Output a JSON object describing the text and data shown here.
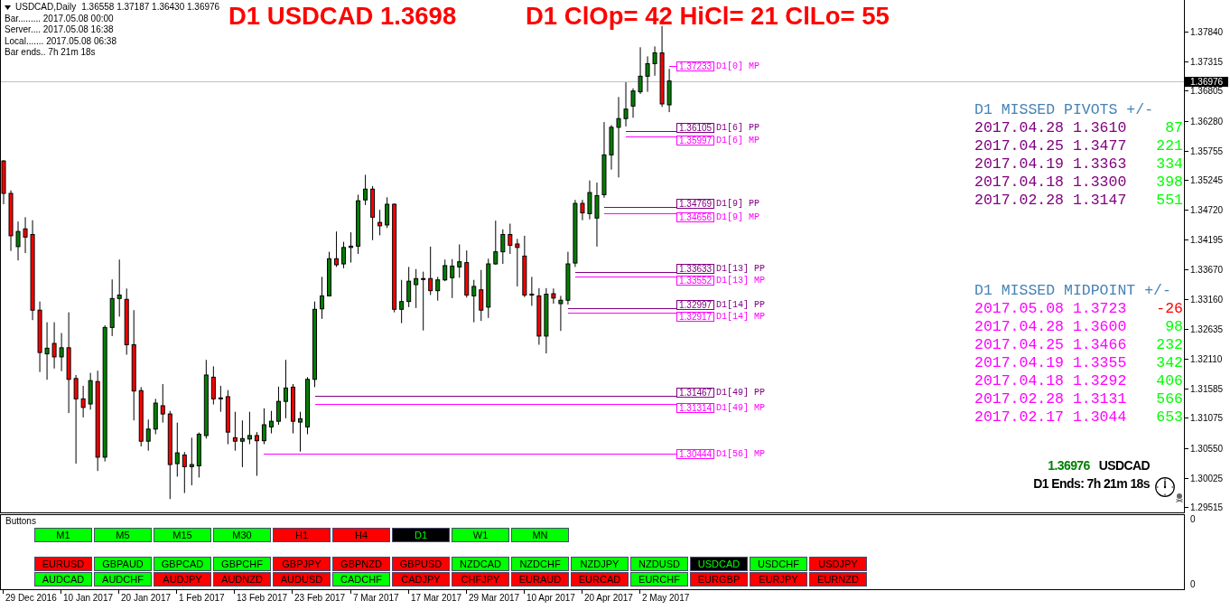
{
  "chart": {
    "symbol": "USDCAD,Daily",
    "ohlc": "1.36558 1.37187 1.36430 1.36976",
    "info": [
      "Bar......... 2017.05.08 00:00",
      "Server.... 2017.05.08 16:38",
      "Local....... 2017.05.08 06:38",
      "Bar ends.. 7h 21m 18s"
    ],
    "headlines": [
      "D1 USDCAD 1.3698",
      "D1 ClOp= 42 HiCl= 21 ClLo= 55"
    ],
    "chart_data": {
      "type": "candlestick",
      "categories": [
        null,
        null,
        null,
        null,
        null,
        null,
        null,
        null,
        null,
        null,
        null,
        null,
        null,
        null,
        null,
        null,
        null,
        null,
        null,
        null,
        null,
        null,
        null,
        null,
        null,
        null,
        null,
        null,
        null,
        null,
        null,
        null,
        null,
        null,
        null,
        null,
        null,
        null,
        null,
        null,
        null,
        null,
        null,
        null,
        null,
        null,
        null,
        null,
        null,
        null,
        null,
        null,
        null,
        null,
        null,
        null,
        null,
        null,
        null,
        null,
        null,
        null,
        null,
        null,
        null,
        null,
        null,
        null,
        null,
        null,
        null,
        null,
        null,
        null,
        null,
        null,
        null,
        null,
        null,
        null,
        null,
        null,
        null,
        null,
        null,
        null,
        null,
        null,
        null,
        null,
        null,
        null,
        null,
        null,
        null,
        null,
        null,
        null,
        null,
        null,
        null,
        null,
        null,
        null,
        null,
        null,
        null,
        null,
        null,
        null,
        null,
        null,
        null,
        null,
        null,
        null,
        null,
        null,
        null,
        null,
        null,
        null,
        null,
        null,
        null,
        null,
        null,
        null,
        null,
        null,
        null,
        null,
        null,
        null,
        null,
        null,
        null,
        null,
        null,
        null,
        null,
        null,
        null,
        null,
        null,
        null,
        null,
        null,
        null,
        null,
        null,
        null,
        null,
        null,
        null,
        null,
        null,
        null,
        null,
        null,
        null,
        null,
        null,
        null,
        null,
        null,
        null,
        null,
        null,
        null
      ],
      "ohlc": [
        [
          1.35575,
          1.3559,
          1.34817,
          1.35007
        ],
        [
          1.35007,
          1.3506,
          1.33999,
          1.34265
        ],
        [
          1.34075,
          1.34514,
          1.33833,
          1.3434
        ],
        [
          1.34386,
          1.3459,
          1.33962,
          1.34242
        ],
        [
          1.34287,
          1.34537,
          1.32788,
          1.32962
        ],
        [
          1.32962,
          1.33113,
          1.31879,
          1.3222
        ],
        [
          1.32197,
          1.3275,
          1.31743,
          1.32296
        ],
        [
          1.32379,
          1.3275,
          1.3194,
          1.32144
        ],
        [
          1.32144,
          1.32561,
          1.31894,
          1.32303
        ],
        [
          1.32303,
          1.32924,
          1.3116,
          1.3175
        ],
        [
          1.31765,
          1.31826,
          1.30274,
          1.31409
        ],
        [
          1.31409,
          1.31637,
          1.31084,
          1.31258
        ],
        [
          1.31319,
          1.31864,
          1.3122,
          1.31728
        ],
        [
          1.31712,
          1.31902,
          1.30145,
          1.30387
        ],
        [
          1.30387,
          1.32697,
          1.30312,
          1.32659
        ],
        [
          1.32659,
          1.335,
          1.32508,
          1.33166
        ],
        [
          1.33166,
          1.33848,
          1.32848,
          1.33227
        ],
        [
          1.33151,
          1.33341,
          1.32182,
          1.32356
        ],
        [
          1.32356,
          1.32962,
          1.31031,
          1.31546
        ],
        [
          1.31553,
          1.31614,
          1.30576,
          1.30667
        ],
        [
          1.30667,
          1.31046,
          1.30501,
          1.30879
        ],
        [
          1.30879,
          1.31409,
          1.30789,
          1.31334
        ],
        [
          1.31288,
          1.31667,
          1.30993,
          1.31144
        ],
        [
          1.31144,
          1.31197,
          1.29653,
          1.30258
        ],
        [
          1.30274,
          1.30993,
          1.30046,
          1.30463
        ],
        [
          1.30425,
          1.30478,
          1.29759,
          1.30221
        ],
        [
          1.30221,
          1.30728,
          1.29895,
          1.30258
        ],
        [
          1.30236,
          1.30819,
          1.30031,
          1.30789
        ],
        [
          1.30766,
          1.32091,
          1.30713,
          1.31826
        ],
        [
          1.31788,
          1.31978,
          1.31311,
          1.31409
        ],
        [
          1.31409,
          1.31637,
          1.31182,
          1.31425
        ],
        [
          1.31447,
          1.31561,
          1.30614,
          1.30826
        ],
        [
          1.30728,
          1.31182,
          1.30501,
          1.30667
        ],
        [
          1.30667,
          1.31031,
          1.30213,
          1.30713
        ],
        [
          1.30705,
          1.31182,
          1.30614,
          1.30766
        ],
        [
          1.30766,
          1.30826,
          1.30061,
          1.30675
        ],
        [
          1.30675,
          1.31243,
          1.30614,
          1.30955
        ],
        [
          1.30917,
          1.31197,
          1.30804,
          1.31016
        ],
        [
          1.31016,
          1.31622,
          1.30955,
          1.31364
        ],
        [
          1.31364,
          1.32091,
          1.31069,
          1.31599
        ],
        [
          1.31614,
          1.31667,
          1.30804,
          1.31016
        ],
        [
          1.31001,
          1.31182,
          1.30486,
          1.31061
        ],
        [
          1.30917,
          1.31788,
          1.30789,
          1.3175
        ],
        [
          1.3175,
          1.33113,
          1.31614,
          1.32977
        ],
        [
          1.32985,
          1.33545,
          1.3281,
          1.33212
        ],
        [
          1.33212,
          1.33984,
          1.33212,
          1.33863
        ],
        [
          1.33863,
          1.3434,
          1.33719,
          1.33757
        ],
        [
          1.33772,
          1.34159,
          1.33697,
          1.3406
        ],
        [
          1.3406,
          1.34325,
          1.33795,
          1.34083
        ],
        [
          1.34083,
          1.34984,
          1.33946,
          1.34878
        ],
        [
          1.34893,
          1.35332,
          1.34802,
          1.35082
        ],
        [
          1.35082,
          1.35135,
          1.34189,
          1.3459
        ],
        [
          1.34499,
          1.34719,
          1.34272,
          1.34439
        ],
        [
          1.34454,
          1.34939,
          1.34401,
          1.34817
        ],
        [
          1.34817,
          1.34832,
          1.32924,
          1.32977
        ],
        [
          1.32977,
          1.33492,
          1.32735,
          1.33113
        ],
        [
          1.33113,
          1.33719,
          1.33015,
          1.33469
        ],
        [
          1.33409,
          1.33681,
          1.33,
          1.33515
        ],
        [
          1.335,
          1.33636,
          1.32606,
          1.33515
        ],
        [
          1.33515,
          1.34075,
          1.33227,
          1.33303
        ],
        [
          1.33303,
          1.33545,
          1.33129,
          1.33492
        ],
        [
          1.33492,
          1.33848,
          1.33469,
          1.33742
        ],
        [
          1.3353,
          1.33856,
          1.33174,
          1.33734
        ],
        [
          1.33719,
          1.34113,
          1.3353,
          1.3381
        ],
        [
          1.33795,
          1.34007,
          1.33182,
          1.33227
        ],
        [
          1.33212,
          1.33492,
          1.3275,
          1.33378
        ],
        [
          1.33318,
          1.33666,
          1.32773,
          1.32962
        ],
        [
          1.33015,
          1.33863,
          1.32826,
          1.33772
        ],
        [
          1.33772,
          1.3453,
          1.33757,
          1.33984
        ],
        [
          1.33984,
          1.34378,
          1.33772,
          1.34287
        ],
        [
          1.34287,
          1.34477,
          1.33946,
          1.34098
        ],
        [
          1.34121,
          1.34211,
          1.33378,
          1.3406
        ],
        [
          1.33909,
          1.34265,
          1.33189,
          1.33227
        ],
        [
          1.33227,
          1.33545,
          1.33038,
          1.33242
        ],
        [
          1.33212,
          1.33348,
          1.32356,
          1.32508
        ],
        [
          1.32508,
          1.33348,
          1.32205,
          1.33242
        ],
        [
          1.3325,
          1.33341,
          1.33076,
          1.33174
        ],
        [
          1.33076,
          1.33212,
          1.32598,
          1.33136
        ],
        [
          1.33136,
          1.33984,
          1.3306,
          1.33772
        ],
        [
          1.33787,
          1.34893,
          1.33719,
          1.34832
        ],
        [
          1.34832,
          1.34893,
          1.34537,
          1.34666
        ],
        [
          1.34651,
          1.35234,
          1.34552,
          1.35022
        ],
        [
          1.34575,
          1.35196,
          1.34075,
          1.34969
        ],
        [
          1.34984,
          1.36256,
          1.34931,
          1.35681
        ],
        [
          1.35681,
          1.36203,
          1.35423,
          1.36165
        ],
        [
          1.36165,
          1.36695,
          1.35287,
          1.36317
        ],
        [
          1.36317,
          1.36953,
          1.3618,
          1.36483
        ],
        [
          1.36536,
          1.36847,
          1.36332,
          1.36801
        ],
        [
          1.36786,
          1.37566,
          1.36748,
          1.37059
        ],
        [
          1.37059,
          1.37407,
          1.36786,
          1.37279
        ],
        [
          1.37279,
          1.37581,
          1.37067,
          1.37468
        ],
        [
          1.37468,
          1.37937,
          1.36521,
          1.36574
        ],
        [
          1.36558,
          1.37187,
          1.3643,
          1.36976
        ],
        null,
        null,
        null,
        null,
        null,
        null,
        null,
        null,
        null,
        null,
        null,
        null,
        null,
        null,
        null,
        null,
        null,
        null,
        null,
        null,
        null,
        null,
        null,
        null,
        null,
        null,
        null,
        null,
        null,
        null,
        null,
        null,
        null,
        null,
        null,
        null,
        null,
        null,
        null,
        null,
        null,
        null,
        null,
        null,
        null,
        null,
        null,
        null,
        null,
        null,
        null,
        null,
        null,
        null,
        null,
        null,
        null,
        null,
        null,
        null,
        null,
        null,
        null,
        null,
        null,
        null,
        null,
        null,
        null,
        null,
        null,
        null,
        null,
        null,
        null,
        null,
        null
      ],
      "ylim": [
        1.2942,
        1.38394
      ],
      "yticks": [
        {
          "value": 1.3784,
          "label": "1.37840"
        },
        {
          "value": 1.37315,
          "label": "1.37315"
        },
        {
          "value": 1.36805,
          "label": "1.36805"
        },
        {
          "value": 1.3628,
          "label": "1.36280"
        },
        {
          "value": 1.35755,
          "label": "1.35755"
        },
        {
          "value": 1.35245,
          "label": "1.35245"
        },
        {
          "value": 1.3472,
          "label": "1.34720"
        },
        {
          "value": 1.34195,
          "label": "1.34195"
        },
        {
          "value": 1.3367,
          "label": "1.33670"
        },
        {
          "value": 1.3316,
          "label": "1.33160"
        },
        {
          "value": 1.32635,
          "label": "1.32635"
        },
        {
          "value": 1.3211,
          "label": "1.32110"
        },
        {
          "value": 1.31585,
          "label": "1.31585"
        },
        {
          "value": 1.31075,
          "label": "1.31075"
        },
        {
          "value": 1.3055,
          "label": "1.30550"
        },
        {
          "value": 1.30025,
          "label": "1.30025"
        },
        {
          "value": 1.29515,
          "label": "1.29515"
        }
      ],
      "ref_lines": [
        {
          "axis": "y",
          "value": 1.36976,
          "label": "1.36976"
        }
      ]
    },
    "time_axis": [
      "29 Dec 2016",
      "10 Jan 2017",
      "20 Jan 2017",
      "1 Feb 2017",
      "13 Feb 2017",
      "23 Feb 2017",
      "7 Mar 2017",
      "17 Mar 2017",
      "29 Mar 2017",
      "10 Apr 2017",
      "20 Apr 2017",
      "2 May 2017"
    ],
    "levels": [
      {
        "kind": "mp",
        "price": "1.37233",
        "tag": "D1[0] MP"
      },
      {
        "kind": "pp",
        "price": "1.36105",
        "tag": "D1[6] PP"
      },
      {
        "kind": "mp",
        "price": "1.35997",
        "tag": "D1[6] MP"
      },
      {
        "kind": "pp",
        "price": "1.34769",
        "tag": "D1[9] PP"
      },
      {
        "kind": "mp",
        "price": "1.34656",
        "tag": "D1[9] MP"
      },
      {
        "kind": "pp",
        "price": "1.33633",
        "tag": "D1[13] PP"
      },
      {
        "kind": "mp",
        "price": "1.33552",
        "tag": "D1[13] MP"
      },
      {
        "kind": "pp",
        "price": "1.32997",
        "tag": "D1[14] PP"
      },
      {
        "kind": "mp",
        "price": "1.32917",
        "tag": "D1[14] MP"
      },
      {
        "kind": "pp",
        "price": "1.31467",
        "tag": "D1[49] PP"
      },
      {
        "kind": "mp",
        "price": "1.31314",
        "tag": "D1[49] MP"
      },
      {
        "kind": "mp",
        "price": "1.30444",
        "tag": "D1[56] MP"
      }
    ],
    "missed_pivots": {
      "title": "D1 MISSED PIVOTS +/-",
      "rows": [
        {
          "entry": "2017.04.28 1.3610",
          "diff": "87",
          "color": "#00ff00"
        },
        {
          "entry": "2017.04.25 1.3477",
          "diff": "221",
          "color": "#00ff00"
        },
        {
          "entry": "2017.04.19 1.3363",
          "diff": "334",
          "color": "#00ff00"
        },
        {
          "entry": "2017.04.18 1.3300",
          "diff": "398",
          "color": "#00ff00"
        },
        {
          "entry": "2017.02.28 1.3147",
          "diff": "551",
          "color": "#00ff00"
        }
      ]
    },
    "missed_midpoints": {
      "title": "D1 MISSED MIDPOINT +/-",
      "rows": [
        {
          "entry": "2017.05.08 1.3723",
          "diff": "-26",
          "color": "#ff0000"
        },
        {
          "entry": "2017.04.28 1.3600",
          "diff": "98",
          "color": "#00ff00"
        },
        {
          "entry": "2017.04.25 1.3466",
          "diff": "232",
          "color": "#00ff00"
        },
        {
          "entry": "2017.04.19 1.3355",
          "diff": "342",
          "color": "#00ff00"
        },
        {
          "entry": "2017.04.18 1.3292",
          "diff": "406",
          "color": "#00ff00"
        },
        {
          "entry": "2017.02.28 1.3131",
          "diff": "566",
          "color": "#00ff00"
        },
        {
          "entry": "2017.02.17 1.3044",
          "diff": "653",
          "color": "#00ff00"
        }
      ]
    },
    "quote": {
      "price": "1.36976",
      "symbol": "USDCAD",
      "countdown": "D1 Ends: 7h 21m 18s"
    }
  },
  "subwindow": {
    "title": "Buttons",
    "axis": [
      "0",
      "0"
    ],
    "timeframes": [
      {
        "label": "M1",
        "color": "#00ff00",
        "selected": false
      },
      {
        "label": "M5",
        "color": "#00ff00",
        "selected": false
      },
      {
        "label": "M15",
        "color": "#00ff00",
        "selected": false
      },
      {
        "label": "M30",
        "color": "#00ff00",
        "selected": false
      },
      {
        "label": "H1",
        "color": "#ff0000",
        "selected": false
      },
      {
        "label": "H4",
        "color": "#ff0000",
        "selected": false
      },
      {
        "label": "D1",
        "color": "#000000",
        "selected": true
      },
      {
        "label": "W1",
        "color": "#00ff00",
        "selected": false
      },
      {
        "label": "MN",
        "color": "#00ff00",
        "selected": false
      }
    ],
    "symbol_rows": [
      {
        "buttons": [
          {
            "label": "EURUSD",
            "color": "#ff0000",
            "selected": false
          },
          {
            "label": "GBPAUD",
            "color": "#00ff00",
            "selected": false
          },
          {
            "label": "GBPCAD",
            "color": "#00ff00",
            "selected": false
          },
          {
            "label": "GBPCHF",
            "color": "#00ff00",
            "selected": false
          },
          {
            "label": "GBPJPY",
            "color": "#ff0000",
            "selected": false
          },
          {
            "label": "GBPNZD",
            "color": "#ff0000",
            "selected": false
          },
          {
            "label": "GBPUSD",
            "color": "#ff0000",
            "selected": false
          },
          {
            "label": "NZDCAD",
            "color": "#00ff00",
            "selected": false
          },
          {
            "label": "NZDCHF",
            "color": "#00ff00",
            "selected": false
          },
          {
            "label": "NZDJPY",
            "color": "#00ff00",
            "selected": false
          },
          {
            "label": "NZDUSD",
            "color": "#00ff00",
            "selected": false
          },
          {
            "label": "USDCAD",
            "color": "#000000",
            "selected": true
          },
          {
            "label": "USDCHF",
            "color": "#00ff00",
            "selected": false
          },
          {
            "label": "USDJPY",
            "color": "#ff0000",
            "selected": false
          }
        ]
      },
      {
        "buttons": [
          {
            "label": "AUDCAD",
            "color": "#00ff00",
            "selected": false
          },
          {
            "label": "AUDCHF",
            "color": "#00ff00",
            "selected": false
          },
          {
            "label": "AUDJPY",
            "color": "#ff0000",
            "selected": false
          },
          {
            "label": "AUDNZD",
            "color": "#ff0000",
            "selected": false
          },
          {
            "label": "AUDUSD",
            "color": "#ff0000",
            "selected": false
          },
          {
            "label": "CADCHF",
            "color": "#00ff00",
            "selected": false
          },
          {
            "label": "CADJPY",
            "color": "#ff0000",
            "selected": false
          },
          {
            "label": "CHFJPY",
            "color": "#ff0000",
            "selected": false
          },
          {
            "label": "EURAUD",
            "color": "#ff0000",
            "selected": false
          },
          {
            "label": "EURCAD",
            "color": "#ff0000",
            "selected": false
          },
          {
            "label": "EURCHF",
            "color": "#00ff00",
            "selected": false
          },
          {
            "label": "EURGBP",
            "color": "#ff0000",
            "selected": false
          },
          {
            "label": "EURJPY",
            "color": "#ff0000",
            "selected": false
          },
          {
            "label": "EURNZD",
            "color": "#ff0000",
            "selected": false
          }
        ]
      }
    ]
  }
}
